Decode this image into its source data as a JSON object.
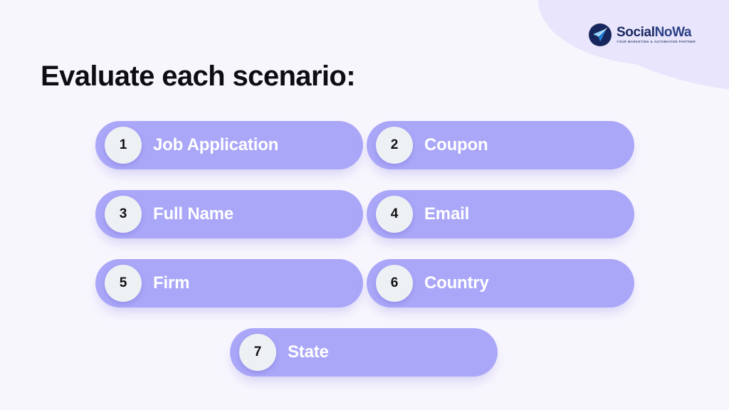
{
  "slide": {
    "title": "Evaluate each scenario:",
    "background_color": "#f8f6fd",
    "accent_color": "#aaa7f9",
    "blob_color": "#e9e5fc"
  },
  "logo": {
    "name": "SocialNoWa",
    "name_part1": "Social",
    "name_part2": "NoWa",
    "tagline": "YOUR MARKETING & AUTOMATION PARTNER",
    "mark": "paper-plane-icon",
    "mark_color": "#17265c",
    "text_color": "#1b2a63"
  },
  "items": [
    {
      "number": "1",
      "label": "Job Application"
    },
    {
      "number": "2",
      "label": "Coupon"
    },
    {
      "number": "3",
      "label": "Full Name"
    },
    {
      "number": "4",
      "label": "Email"
    },
    {
      "number": "5",
      "label": "Firm"
    },
    {
      "number": "6",
      "label": "Country"
    },
    {
      "number": "7",
      "label": "State"
    }
  ]
}
